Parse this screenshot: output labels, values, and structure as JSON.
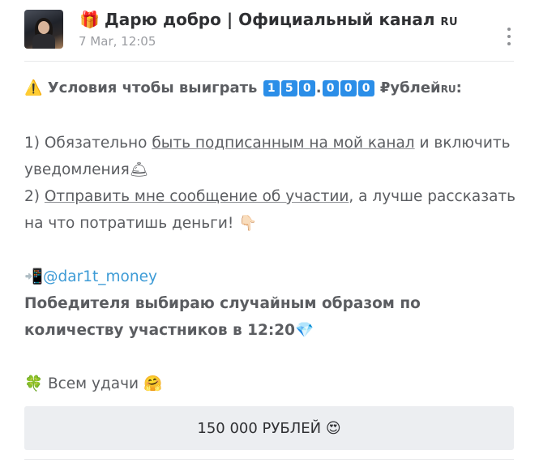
{
  "channel": {
    "gift_emoji": "🎁",
    "title": "Дарю добро | Официальный канал",
    "title_suffix": "RU",
    "date": "7 Mar, 12:05"
  },
  "post": {
    "warning_emoji": "⚠️",
    "headline": "Условия чтобы выиграть",
    "prize_digits": [
      "1",
      "5",
      "0",
      "0",
      "0",
      "0"
    ],
    "prize_separator": ".",
    "currency": "₽ублей",
    "currency_suffix": "RU",
    "colon": ":",
    "cond1_prefix": "1) Обязательно ",
    "cond1_link": "быть подписанным на мой канал",
    "cond1_suffix": " и включить уведомления",
    "cond1_emoji": "🛎",
    "cond2_prefix": "2) ",
    "cond2_link": "Отправить мне сообщение об участии",
    "cond2_suffix": ", а лучше рассказать на что потратишь деньги!",
    "cond2_emoji": "👇🏻",
    "phone_emoji": "📲",
    "mention": "@dar1t_money",
    "winner_text": "Победителя выбираю случайным образом по количеству участников в 12:20",
    "diamond_emoji": "💎",
    "clover_emoji": "🍀",
    "luck_text": "Всем удачи",
    "hug_emoji": "🤗"
  },
  "reaction_button": {
    "label": "150 000 РУБЛЕЙ",
    "emoji": "😍"
  }
}
